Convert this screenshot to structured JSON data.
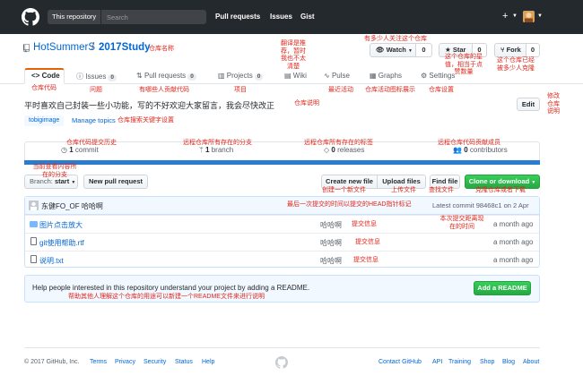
{
  "header": {
    "scope_label": "This repository",
    "search_placeholder": "Search",
    "nav": [
      "Pull requests",
      "Issues",
      "Gist"
    ],
    "plus": "+"
  },
  "repo": {
    "owner": "HotSummerS",
    "separator": "/",
    "name": "2017Study",
    "watch_label": "Watch",
    "watch_count": "0",
    "star_label": "Star",
    "star_count": "0",
    "fork_label": "Fork",
    "fork_count": "0"
  },
  "tabs": [
    {
      "label": "Code"
    },
    {
      "label": "Issues",
      "count": "0"
    },
    {
      "label": "Pull requests",
      "count": "0"
    },
    {
      "label": "Projects",
      "count": "0"
    },
    {
      "label": "Wiki"
    },
    {
      "label": "Pulse"
    },
    {
      "label": "Graphs"
    },
    {
      "label": "Settings"
    }
  ],
  "description": "平时喜欢自己封装一些小功能，写的不好欢迎大家留言，我会尽快改正",
  "edit_label": "Edit",
  "topics": {
    "tag": "tobigimage",
    "manage": "Manage topics"
  },
  "summary": {
    "commits_num": "1",
    "commits_label": "commit",
    "branch_num": "1",
    "branch_label": "branch",
    "releases_num": "0",
    "releases_label": "releases",
    "contributors_num": "0",
    "contributors_label": "contributors"
  },
  "file_nav": {
    "branch_prefix": "Branch:",
    "branch": "start",
    "new_pr": "New pull request",
    "create_file": "Create new file",
    "upload": "Upload files",
    "find": "Find file",
    "clone": "Clone or download"
  },
  "commit_tease": {
    "author": "东健FO_OF 哈哈啊",
    "latest": "Latest commit 98468c1 on 2 Apr"
  },
  "files": [
    {
      "name": "图片点击放大",
      "type": "dir",
      "message": "哈哈啊",
      "age": "a month ago"
    },
    {
      "name": "git使用帮助.rtf",
      "type": "file",
      "message": "哈哈啊",
      "age": "a month ago"
    },
    {
      "name": "说明.txt",
      "type": "file",
      "message": "哈哈啊",
      "age": "a month ago"
    }
  ],
  "readme": {
    "text": "Help people interested in this repository understand your project by adding a README.",
    "button": "Add a README"
  },
  "footer": {
    "copyright": "© 2017 GitHub, Inc.",
    "left_links": [
      "Terms",
      "Privacy",
      "Security",
      "Status",
      "Help"
    ],
    "right_links": [
      "Contact GitHub",
      "API",
      "Training",
      "Shop",
      "Blog",
      "About"
    ]
  },
  "annotations": {
    "repo_name": "仓库名称",
    "translate": "翻译是推\n荐，暂时\n我也不太\n清楚",
    "watchers": "有多少人关注这个仓库",
    "stars": "这个仓库的星\n值，相当于点\n赞数量",
    "forks": "这个仓库已经\n被多少人克隆",
    "code": "仓库代码",
    "issues": "问题",
    "pulls": "有哪些人贡献代码",
    "projects": "项目",
    "pulse": "最近活动",
    "graphs": "仓库活动图标展示",
    "settings": "仓库设置",
    "edit": "修改\n仓库\n说明",
    "description": "仓库说明",
    "topics": "仓库搜索关键字设置",
    "commits": "仓库代码提交历史",
    "branches": "远程仓库所有存在的分支",
    "tags": "远程仓库所有存在的标签",
    "contributors": "远程仓库代码贡献成员",
    "current_branch": "当前查看内容所\n在的分支",
    "create_file": "创建一个新文件",
    "upload": "上传文件",
    "find": "查找文件",
    "clone": "克隆仓库或者下载",
    "latest_commit": "最后一次提交的时间以提交的HEAD指针标记",
    "commit_msg1": "提交信息",
    "commit_msg2": "提交信息",
    "commit_msg3": "提交信息",
    "commit_time": "本次提交距离现\n在的时间",
    "readme": "帮助其他人理解这个仓库的用途可以新建一个README文件来进行说明"
  }
}
